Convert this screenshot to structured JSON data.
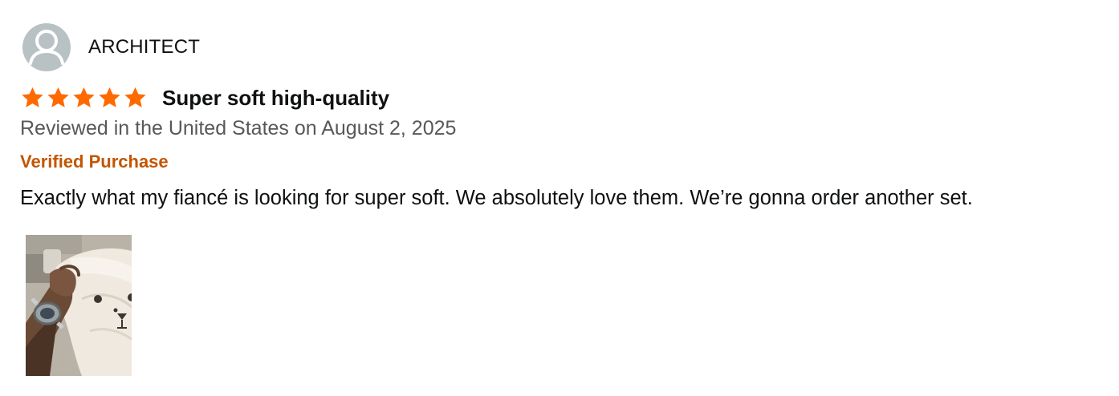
{
  "reviewer": {
    "name": "ARCHITECT",
    "avatar_icon": "person-silhouette-icon"
  },
  "review": {
    "rating": 5,
    "rating_max": 5,
    "star_icon": "star-icon",
    "star_color": "#ff6a00",
    "title": "Super soft high-quality",
    "date_line": "Reviewed in the United States on August 2, 2025",
    "verified_label": "Verified Purchase",
    "verified_color": "#c45500",
    "body": "Exactly what my fiancé is looking for super soft. We absolutely love them. We’re gonna order another set."
  },
  "photos": [
    {
      "icon": "review-photo-thumbnail"
    }
  ]
}
